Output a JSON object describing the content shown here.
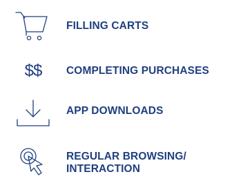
{
  "colors": {
    "text": "#1f3f7f",
    "icon": "#1f3f7f"
  },
  "items": [
    {
      "icon": "cart-icon",
      "label": "FILLING CARTS"
    },
    {
      "icon": "dollar-icon",
      "label": "COMPLETING PURCHASES",
      "glyph": "$$"
    },
    {
      "icon": "download-icon",
      "label": "APP DOWNLOADS"
    },
    {
      "icon": "cursor-click-icon",
      "label_lines": [
        "REGULAR BROWSING/",
        "INTERACTION"
      ]
    }
  ]
}
